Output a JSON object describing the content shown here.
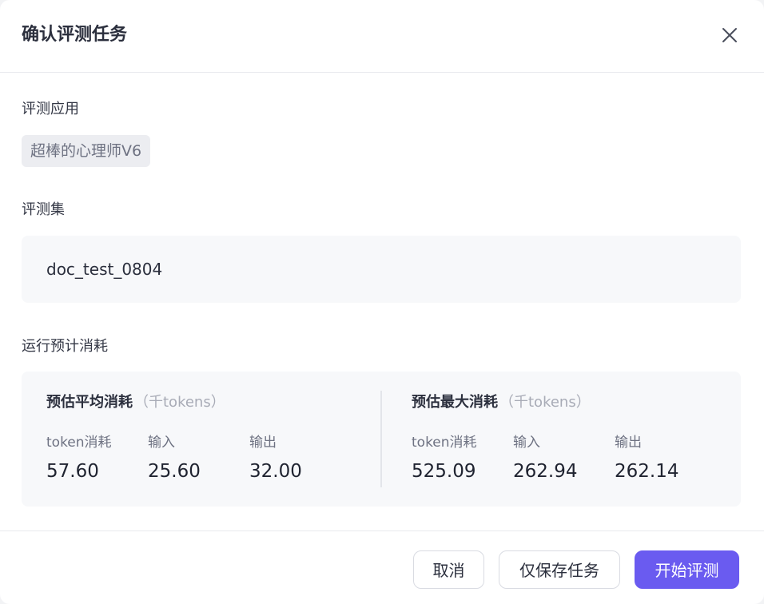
{
  "modal": {
    "title": "确认评测任务",
    "close_icon": "close-icon"
  },
  "app_section": {
    "label": "评测应用",
    "app_name": "超棒的心理师V6"
  },
  "dataset_section": {
    "label": "评测集",
    "dataset_name": "doc_test_0804"
  },
  "cost_section": {
    "label": "运行预计消耗",
    "average": {
      "title": "预估平均消耗",
      "unit": "（千tokens）",
      "metrics": [
        {
          "label": "token消耗",
          "value": "57.60"
        },
        {
          "label": "输入",
          "value": "25.60"
        },
        {
          "label": "输出",
          "value": "32.00"
        }
      ]
    },
    "maximum": {
      "title": "预估最大消耗",
      "unit": "（千tokens）",
      "metrics": [
        {
          "label": "token消耗",
          "value": "525.09"
        },
        {
          "label": "输入",
          "value": "262.94"
        },
        {
          "label": "输出",
          "value": "262.14"
        }
      ]
    }
  },
  "footer": {
    "cancel_label": "取消",
    "save_only_label": "仅保存任务",
    "start_label": "开始评测"
  },
  "colors": {
    "primary": "#6a5bf0",
    "panel_bg": "#f7f8fa",
    "tag_bg": "#ecedf1"
  }
}
